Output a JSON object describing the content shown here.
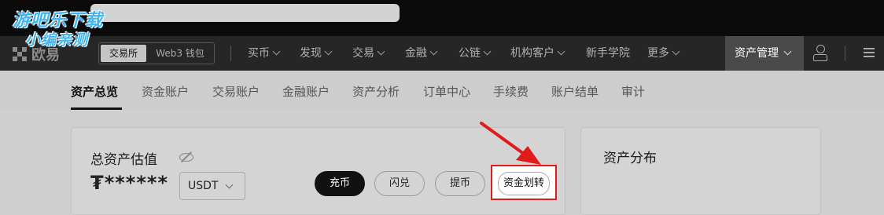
{
  "watermark": {
    "line1": "游吧乐下载",
    "line2": "小编亲测"
  },
  "nav": {
    "logo_text": "欧易",
    "exchange_tab": "交易所",
    "web3_tab": "Web3 钱包",
    "menus": [
      "买币",
      "发现",
      "交易",
      "金融",
      "公链",
      "机构客户",
      "新手学院",
      "更多"
    ],
    "asset_management": "资产管理"
  },
  "tabs": [
    "资产总览",
    "资金账户",
    "交易账户",
    "金融账户",
    "资产分析",
    "订单中心",
    "手续费",
    "账户结单",
    "审计"
  ],
  "overview": {
    "title": "总资产估值",
    "balance": "₮******",
    "currency": "USDT",
    "buttons": {
      "deposit": "充币",
      "convert": "闪兑",
      "withdraw": "提币",
      "transfer": "资金划转"
    }
  },
  "distribution": {
    "title": "资产分布"
  },
  "colors": {
    "highlight": "#e01b1b",
    "watermark": "#3fb6f2"
  }
}
